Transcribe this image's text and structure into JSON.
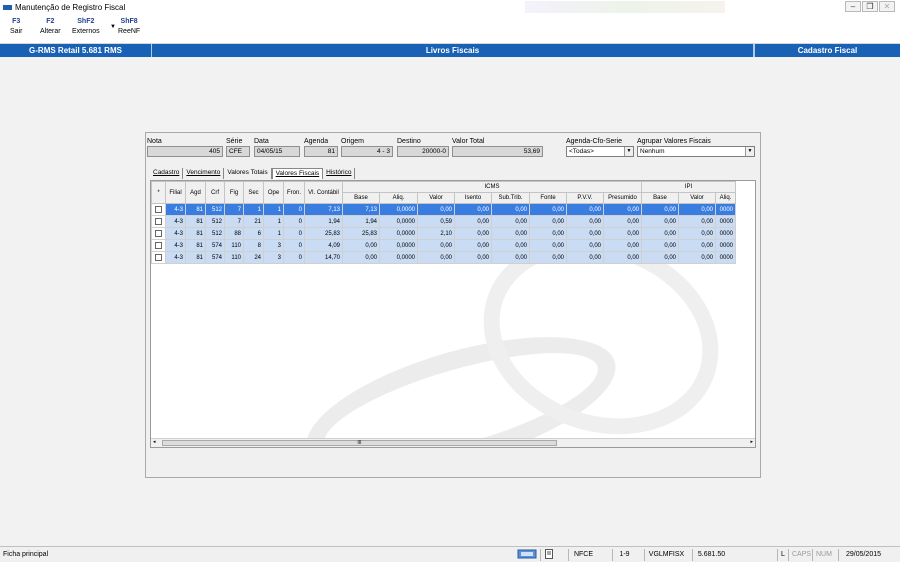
{
  "window": {
    "title": "Manutenção de Registro Fiscal"
  },
  "toolbar": {
    "buttons": [
      {
        "key": "F3",
        "label": "Sair"
      },
      {
        "key": "F2",
        "label": "Alterar"
      },
      {
        "key": "ShF2",
        "label": "Externos"
      },
      {
        "key": "ShF8",
        "label": "ReeNF"
      }
    ]
  },
  "header": {
    "app": "G-RMS Retail 5.681 RMS",
    "module": "Livros Fiscais",
    "screen": "Cadastro Fiscal"
  },
  "form": {
    "nota_label": "Nota",
    "nota": "405",
    "serie_label": "Série",
    "serie": "CFE",
    "data_label": "Data",
    "data": "04/05/15",
    "agenda_label": "Agenda",
    "agenda": "81",
    "origem_label": "Origem",
    "origem": "4 - 3",
    "destino_label": "Destino",
    "destino": "20000-0",
    "valor_total_label": "Valor Total",
    "valor_total": "53,69",
    "agenda_cfo_label": "Agenda-Cfo-Serie",
    "agenda_cfo": "<Todas>",
    "agrupar_label": "Agrupar Valores Fiscais",
    "agrupar": "Nenhum"
  },
  "tabs": [
    "Cadastro",
    "Vencimento",
    "Valores Totais",
    "Valores Fiscais",
    "Histórico"
  ],
  "grid": {
    "group_icms": "ICMS",
    "group_ipi": "IPI",
    "columns": [
      "*",
      "Filial",
      "Agd",
      "Crf",
      "Fig",
      "Sec",
      "Ope",
      "Fron.",
      "Vl. Contábil",
      "Base",
      "Aliq.",
      "Valor",
      "Isento",
      "Sub.Trib.",
      "Fonte",
      "P.V.V.",
      "Presumido",
      "Base",
      "Valor",
      "Aliq."
    ],
    "rows": [
      [
        "",
        "4-3",
        "81",
        "512",
        "7",
        "1",
        "1",
        "0",
        "7,13",
        "7,13",
        "0,0000",
        "0,00",
        "0,00",
        "0,00",
        "0,00",
        "0,00",
        "0,00",
        "0,00",
        "0,00",
        "0000"
      ],
      [
        "",
        "4-3",
        "81",
        "512",
        "7",
        "21",
        "1",
        "0",
        "1,94",
        "1,94",
        "0,0000",
        "0,59",
        "0,00",
        "0,00",
        "0,00",
        "0,00",
        "0,00",
        "0,00",
        "0,00",
        "0000"
      ],
      [
        "",
        "4-3",
        "81",
        "512",
        "88",
        "6",
        "1",
        "0",
        "25,83",
        "25,83",
        "0,0000",
        "2,10",
        "0,00",
        "0,00",
        "0,00",
        "0,00",
        "0,00",
        "0,00",
        "0,00",
        "0000"
      ],
      [
        "",
        "4-3",
        "81",
        "574",
        "110",
        "8",
        "3",
        "0",
        "4,09",
        "0,00",
        "0,0000",
        "0,00",
        "0,00",
        "0,00",
        "0,00",
        "0,00",
        "0,00",
        "0,00",
        "0,00",
        "0000"
      ],
      [
        "",
        "4-3",
        "81",
        "574",
        "110",
        "24",
        "3",
        "0",
        "14,70",
        "0,00",
        "0,0000",
        "0,00",
        "0,00",
        "0,00",
        "0,00",
        "0,00",
        "0,00",
        "0,00",
        "0,00",
        "0000"
      ]
    ],
    "scroll_grip": "III"
  },
  "status": {
    "left": "Ficha principal",
    "items": [
      "NFCE",
      "1-9",
      "VGLMFISX",
      "5.681.50"
    ],
    "l": "L",
    "caps": "CAPS",
    "num": "NUM",
    "date": "29/05/2015"
  }
}
